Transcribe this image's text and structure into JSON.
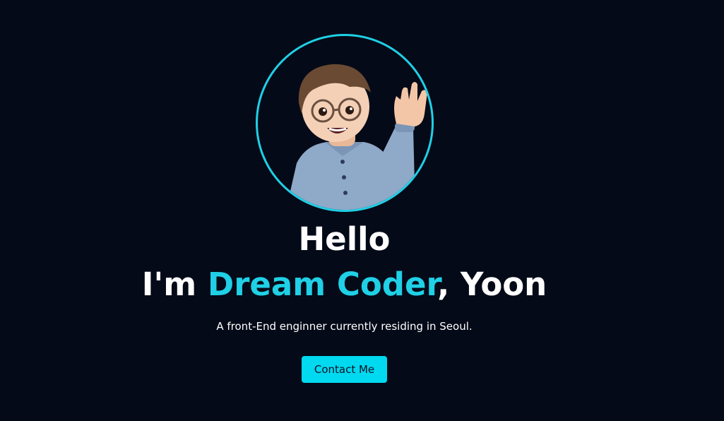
{
  "hero": {
    "greeting": "Hello",
    "headline_prefix": "I'm ",
    "headline_name": "Dream Coder",
    "headline_suffix": ", Yoon",
    "description": "A front-End enginner currently residing in Seoul.",
    "contact_label": "Contact Me",
    "avatar_icon": "memoji-avatar-waving"
  },
  "colors": {
    "background": "#050a18",
    "accent": "#1fd0e6",
    "button": "#00d9ef",
    "button_text": "#0b1024",
    "text": "#ffffff"
  }
}
